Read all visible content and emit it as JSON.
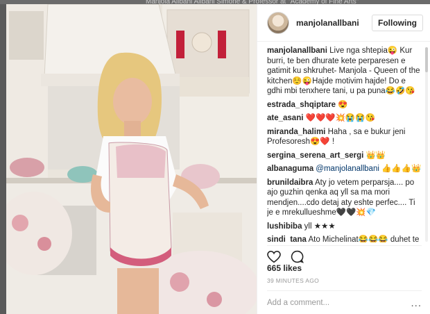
{
  "backdrop": {
    "text": "Manjola Allbani Allbani Simone & Professor at \"Academy of Fine Arts\""
  },
  "post": {
    "username": "manjolanallbani",
    "follow_label": "Following",
    "likes": "665 likes",
    "time": "39 MINUTES AGO",
    "add_comment_placeholder": "Add a comment...",
    "more_label": "..."
  },
  "comments": [
    {
      "user": "manjolanallbani",
      "text": " Live nga shtepia😜 Kur burri, te ben dhurate kete perparesen e gatimit ku shkruhet- Manjola - Queen of the kitchen☺️😜Hajde motivim hajde! Do e gdhi mbi tenxhere tani, u pa puna😂🤣😘"
    },
    {
      "user": "estrada_shqiptare",
      "text": " 😍"
    },
    {
      "user": "ate_asani",
      "text": " ❤️❤️❤️💥😭😭😘"
    },
    {
      "user": "miranda_halimi",
      "text": " Haha , sa e bukur jeni Profesoresh😍❤️ !"
    },
    {
      "user": "sergina_serena_art_sergi",
      "text": " 👑👑"
    },
    {
      "user": "albanaguma",
      "mention": " @manjolanallbani",
      "text": " 👍👍👍👑"
    },
    {
      "user": "brunildaibra",
      "text": " Aty jo vetem perparsja.... po ajo guzhin qenka aq yll sa ma mori mendjen....cdo detaj aty eshte perfec.... Ti je e mrekullueshme🖤🖤💥💎"
    },
    {
      "user": "lushibiba",
      "text": " yll ★★★"
    },
    {
      "user": "sindi_tana",
      "text": " Ato Michelinat😂😂😂 duhet te"
    }
  ]
}
